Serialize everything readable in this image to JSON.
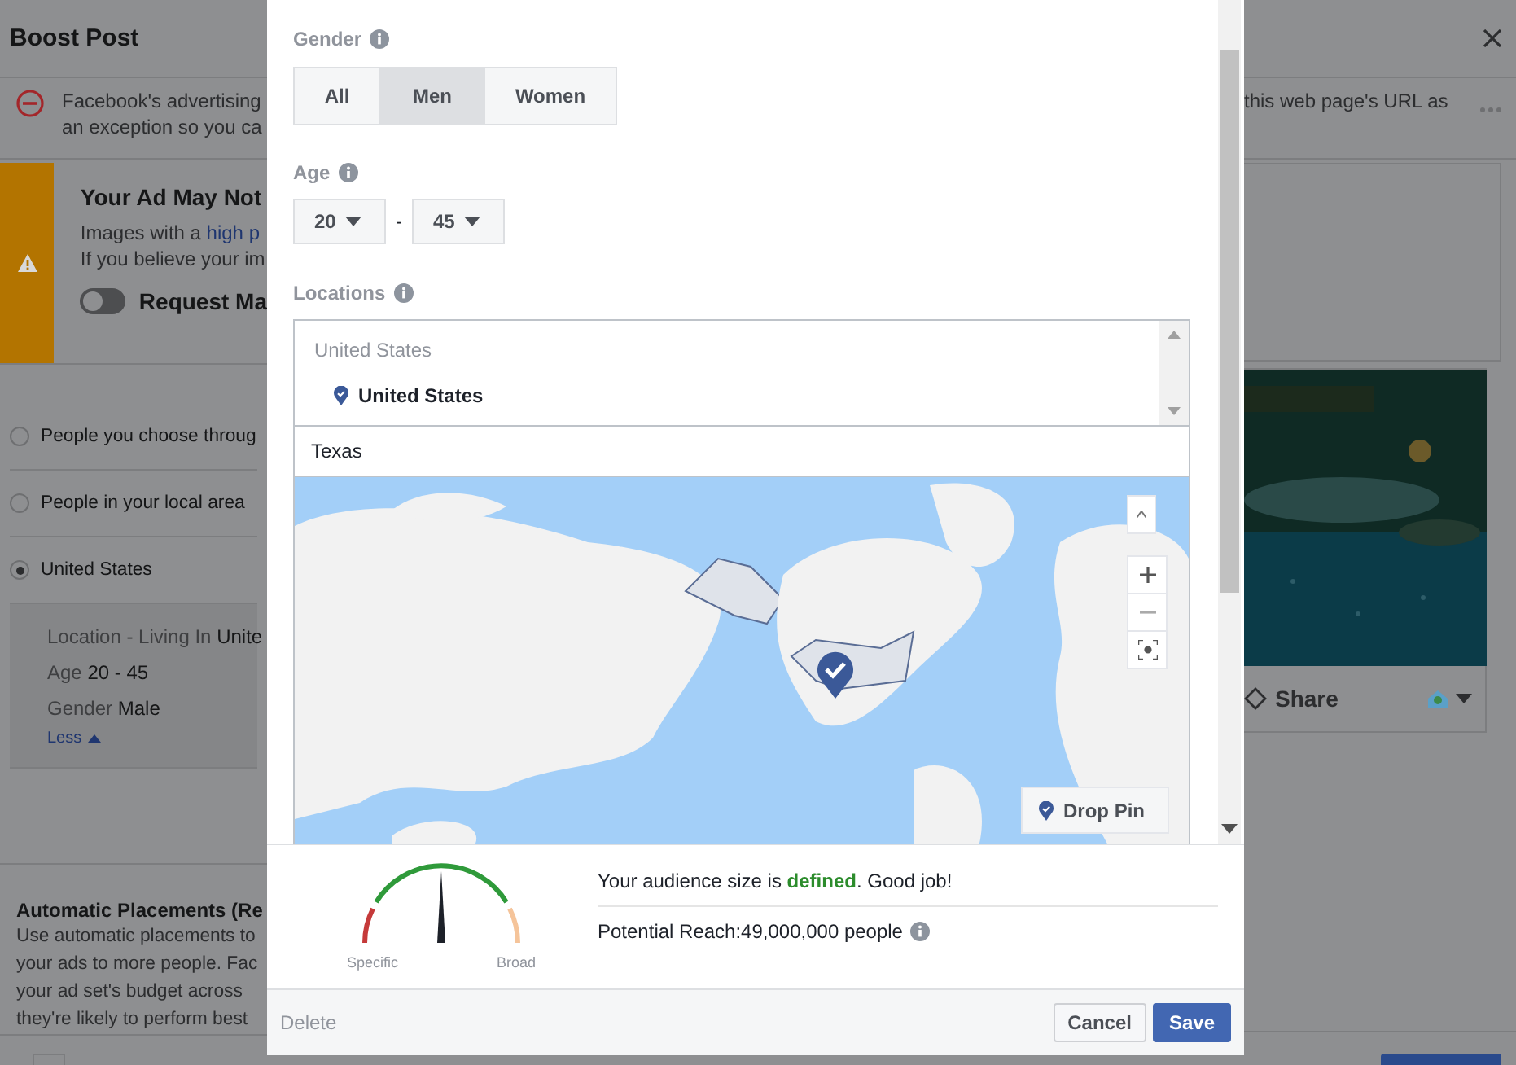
{
  "page": {
    "title": "Boost Post",
    "notice": {
      "lines": [
        "Facebook's advertising",
        "an exception so you ca"
      ],
      "right_text": "this web page's URL as"
    },
    "warning": {
      "title": "Your Ad May Not",
      "line_1": "Images with a ",
      "line_1_link": "high p",
      "line_2": "If you believe your im",
      "toggle": {
        "label": "Request Ma",
        "on": false
      }
    },
    "audience_options": [
      {
        "label": "People you choose throug",
        "selected": false
      },
      {
        "label": "People in your local area",
        "selected": false
      },
      {
        "label": "United States",
        "selected": true
      }
    ],
    "audience_details": [
      {
        "label": "Location - Living In",
        "value": "Unite"
      },
      {
        "label": "Age",
        "value": "20 - 45"
      },
      {
        "label": "Gender",
        "value": "Male"
      }
    ],
    "less_link": "Less",
    "placements": {
      "title": "Automatic Placements (Re",
      "lines": [
        "Use automatic placements to",
        "your ads to more people. Fac",
        "your ad set's budget across",
        "they're likely to perform best"
      ]
    },
    "post_actions": {
      "share": "Share"
    }
  },
  "dialog": {
    "gender": {
      "label": "Gender",
      "options": [
        {
          "label": "All",
          "selected": false
        },
        {
          "label": "Men",
          "selected": true
        },
        {
          "label": "Women",
          "selected": false
        }
      ]
    },
    "age": {
      "label": "Age",
      "from": "20",
      "separator": "-",
      "to": "45"
    },
    "locations": {
      "label": "Locations",
      "group": "United States",
      "items": [
        {
          "name": "United States"
        }
      ],
      "search_value": "Texas",
      "drop_pin": "Drop Pin"
    },
    "audience_meter": {
      "min_label": "Specific",
      "max_label": "Broad"
    },
    "audience_status": "Your audience size is **defined**. Good job!",
    "potential_reach": "Potential Reach:49,000,000 people",
    "buttons": {
      "delete": "Delete",
      "cancel": "Cancel",
      "save": "Save"
    }
  }
}
